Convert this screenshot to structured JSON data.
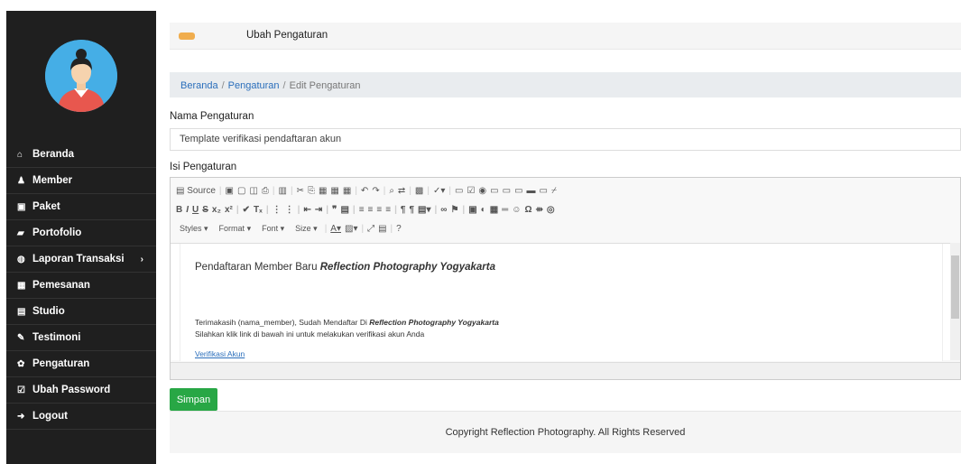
{
  "header": {
    "title": "Ubah Pengaturan"
  },
  "sidebar": {
    "items": [
      {
        "icon": "home-icon",
        "glyph": "⌂",
        "label": "Beranda"
      },
      {
        "icon": "user-icon",
        "glyph": "♟",
        "label": "Member"
      },
      {
        "icon": "image-icon",
        "glyph": "▣",
        "label": "Paket"
      },
      {
        "icon": "folder-icon",
        "glyph": "▰",
        "label": "Portofolio"
      },
      {
        "icon": "globe-icon",
        "glyph": "◍",
        "label": "Laporan Transaksi"
      },
      {
        "icon": "calendar-icon",
        "glyph": "▦",
        "label": "Pemesanan"
      },
      {
        "icon": "picture-icon",
        "glyph": "▤",
        "label": "Studio"
      },
      {
        "icon": "pencil-icon",
        "glyph": "✎",
        "label": "Testimoni"
      },
      {
        "icon": "gear-icon",
        "glyph": "✿",
        "label": "Pengaturan"
      },
      {
        "icon": "edit-icon",
        "glyph": "☑",
        "label": "Ubah Password"
      },
      {
        "icon": "logout-icon",
        "glyph": "➜",
        "label": "Logout"
      }
    ],
    "submenu_chevron": "›"
  },
  "breadcrumb": {
    "home": "Beranda",
    "section": "Pengaturan",
    "current": "Edit Pengaturan",
    "separator": "/"
  },
  "form": {
    "name_label": "Nama Pengaturan",
    "name_value": "Template verifikasi pendaftaran akun",
    "content_label": "Isi Pengaturan",
    "save_label": "Simpan"
  },
  "editor": {
    "source_label": "Source",
    "styles_label": "Styles",
    "format_label": "Format",
    "font_label": "Font",
    "size_label": "Size",
    "heading_text": "Pendaftaran Member Baru ",
    "heading_italic": "Reflection Photography Yogyakarta",
    "line1_text": "Terimakasih (nama_member), Sudah Mendaftar Di ",
    "line1_italic": "Reflection Photography Yogyakarta",
    "line2_text": "Silahkan klik link di bawah ini untuk melakukan verifikasi akun Anda",
    "link_text": "Verifikasi Akun"
  },
  "footer": {
    "text": "Copyright Reflection Photography. All Rights Reserved"
  },
  "colors": {
    "sidebar": "#1f1f1f",
    "accent": "#f0ad4e",
    "save": "#28a745",
    "link": "#2a6ebb",
    "avatar_bg": "#45aee6"
  }
}
